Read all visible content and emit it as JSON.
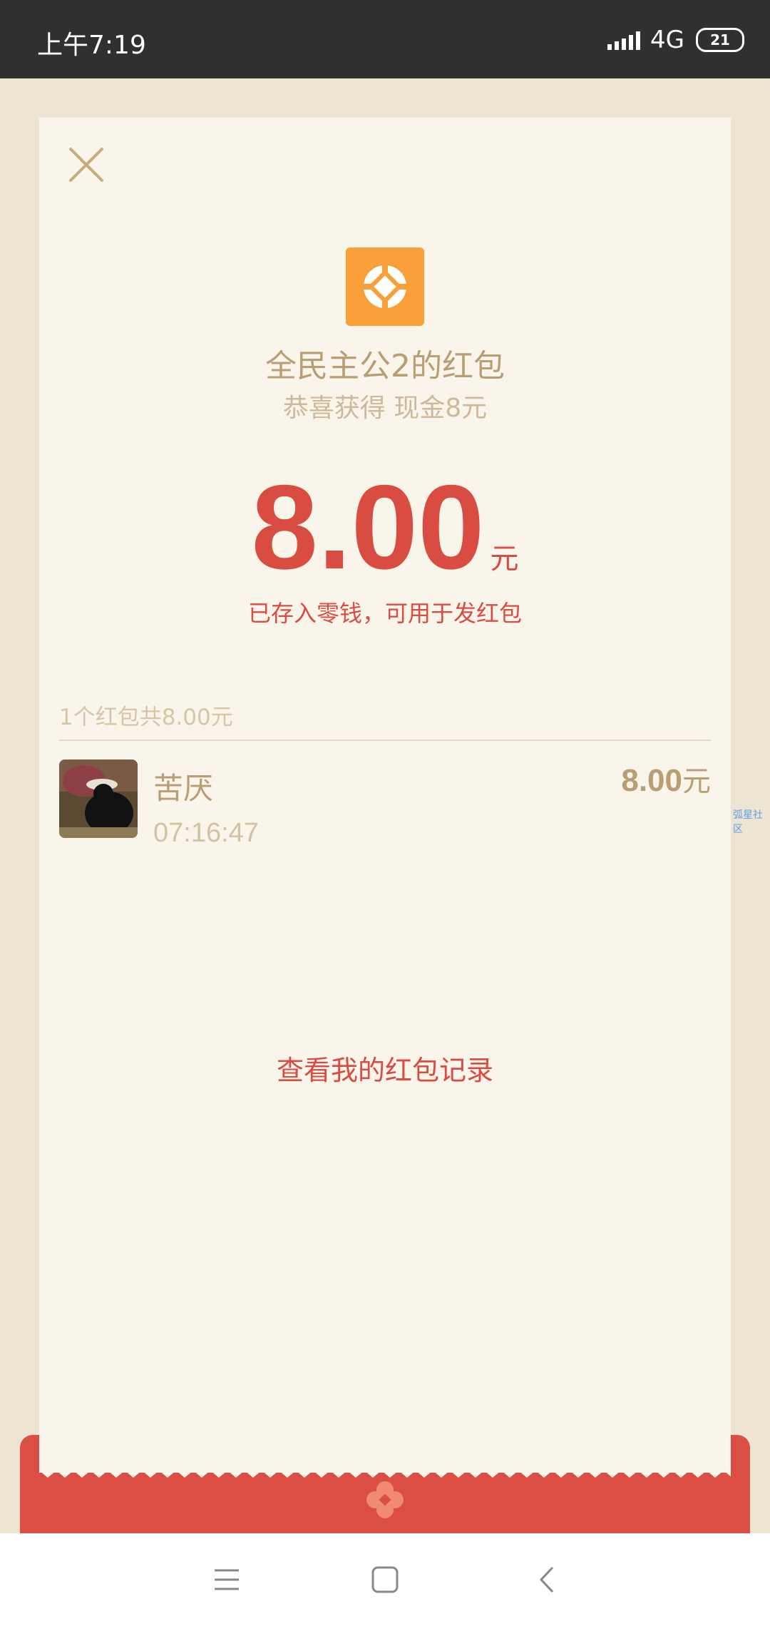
{
  "status_bar": {
    "time": "上午7:19",
    "network": "4G",
    "battery": "21"
  },
  "packet": {
    "sender_title": "全民主公2的红包",
    "wish": "恭喜获得 现金8元",
    "amount": "8.00",
    "amount_unit": "元",
    "stored_note": "已存入零钱，可用于发红包",
    "summary": "1个红包共8.00元",
    "records_link": "查看我的红包记录"
  },
  "receivers": [
    {
      "name": "苦厌",
      "time": "07:16:47",
      "amount": "8.00",
      "unit": "元",
      "avatar": "cat-photo"
    }
  ],
  "watermark": "弧星社区",
  "colors": {
    "accent_red": "#d94c41",
    "gold_text": "#b99e73",
    "card_bg": "#faf5ea",
    "logo_orange": "#f9a03a"
  },
  "icons": {
    "close": "close-icon",
    "logo": "game-logo-icon",
    "footer": "flower-icon",
    "nav_menu": "menu-icon",
    "nav_home": "home-icon",
    "nav_back": "back-icon"
  }
}
